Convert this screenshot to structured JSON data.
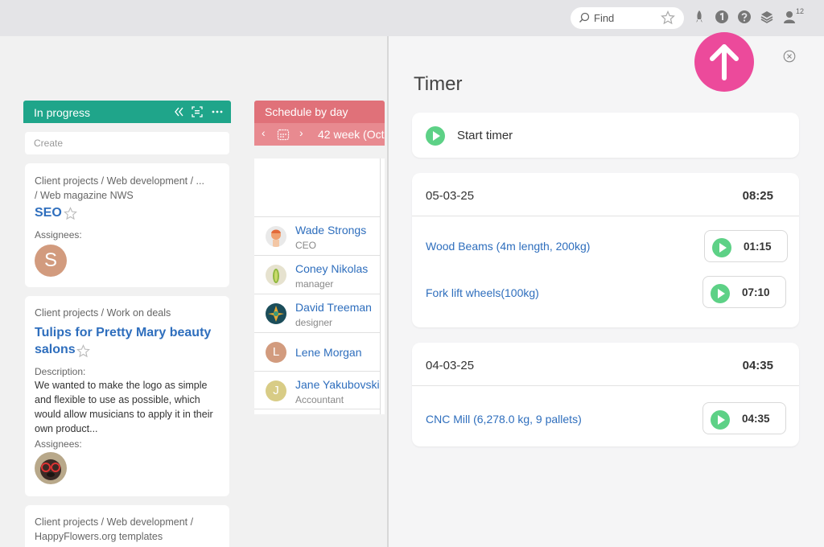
{
  "topbar": {
    "search_placeholder": "Find",
    "notification_count": "12",
    "icons": [
      "search-icon",
      "star-icon",
      "rocket-icon",
      "info-icon",
      "help-icon",
      "layers-icon",
      "user-icon"
    ]
  },
  "board": {
    "column": {
      "title": "In progress",
      "create_placeholder": "Create",
      "cards": [
        {
          "path_line1": "Client projects / Web development / ...",
          "path_line2": "/ Web magazine NWS",
          "title": "SEO",
          "assignees_label": "Assignees:",
          "avatar_letter": "S"
        },
        {
          "path_line1": "Client projects / Work on deals",
          "title_line1": "Tulips for Pretty Mary beauty",
          "title_line2": "salons",
          "description_label": "Description:",
          "desc_lines": [
            "We wanted to make the logo as simple",
            "and flexible to use as possible, which",
            "would allow musicians to apply it in their",
            "own product..."
          ],
          "assignees_label": "Assignees:"
        },
        {
          "path_line1": "Client projects / Web development /",
          "path_line2": "HappyFlowers.org templates"
        }
      ]
    },
    "schedule": {
      "title": "Schedule by day",
      "week_label": "42 week  (Oct",
      "people": [
        {
          "name": "Wade Strongs",
          "role": "CEO"
        },
        {
          "name": "Coney Nikolas",
          "role": "manager"
        },
        {
          "name": "David Treeman",
          "role": "designer"
        },
        {
          "name": "Lene Morgan",
          "role": "",
          "initial": "L"
        },
        {
          "name": "Jane Yakubovski",
          "role": "Accountant",
          "initial": "J"
        }
      ]
    }
  },
  "timer": {
    "title": "Timer",
    "start_label": "Start timer",
    "days": [
      {
        "date": "05-03-25",
        "total": "08:25",
        "entries": [
          {
            "name": "Wood Beams (4m length, 200kg)",
            "time": "01:15"
          },
          {
            "name": "Fork lift wheels(100kg)",
            "time": "07:10"
          }
        ]
      },
      {
        "date": "04-03-25",
        "total": "04:35",
        "entries": [
          {
            "name": "CNC Mill (6,278.0 kg, 9 pallets)",
            "time": "04:35"
          }
        ]
      }
    ]
  },
  "colors": {
    "in_progress": "#1fa58a",
    "schedule": "#e07179",
    "link": "#2e6ebd",
    "play": "#5dd186",
    "fab": "#ec4a9b"
  }
}
